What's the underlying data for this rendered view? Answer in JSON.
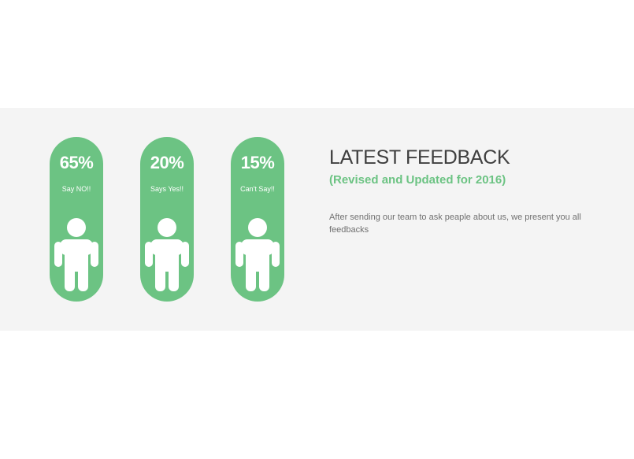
{
  "colors": {
    "accent": "#6cc383",
    "band": "#f4f4f4",
    "heading": "#3f3f3f",
    "text": "#707070"
  },
  "stats": [
    {
      "percent": "65%",
      "label": "Say NO!!",
      "icon": "person-icon"
    },
    {
      "percent": "20%",
      "label": "Says Yes!!",
      "icon": "person-icon"
    },
    {
      "percent": "15%",
      "label": "Can't Say!!",
      "icon": "person-icon"
    }
  ],
  "feedback": {
    "title": "LATEST FEEDBACK",
    "subtitle": "(Revised and Updated for 2016)",
    "description": "After sending our team to ask peaple about us, we present you all feedbacks"
  }
}
